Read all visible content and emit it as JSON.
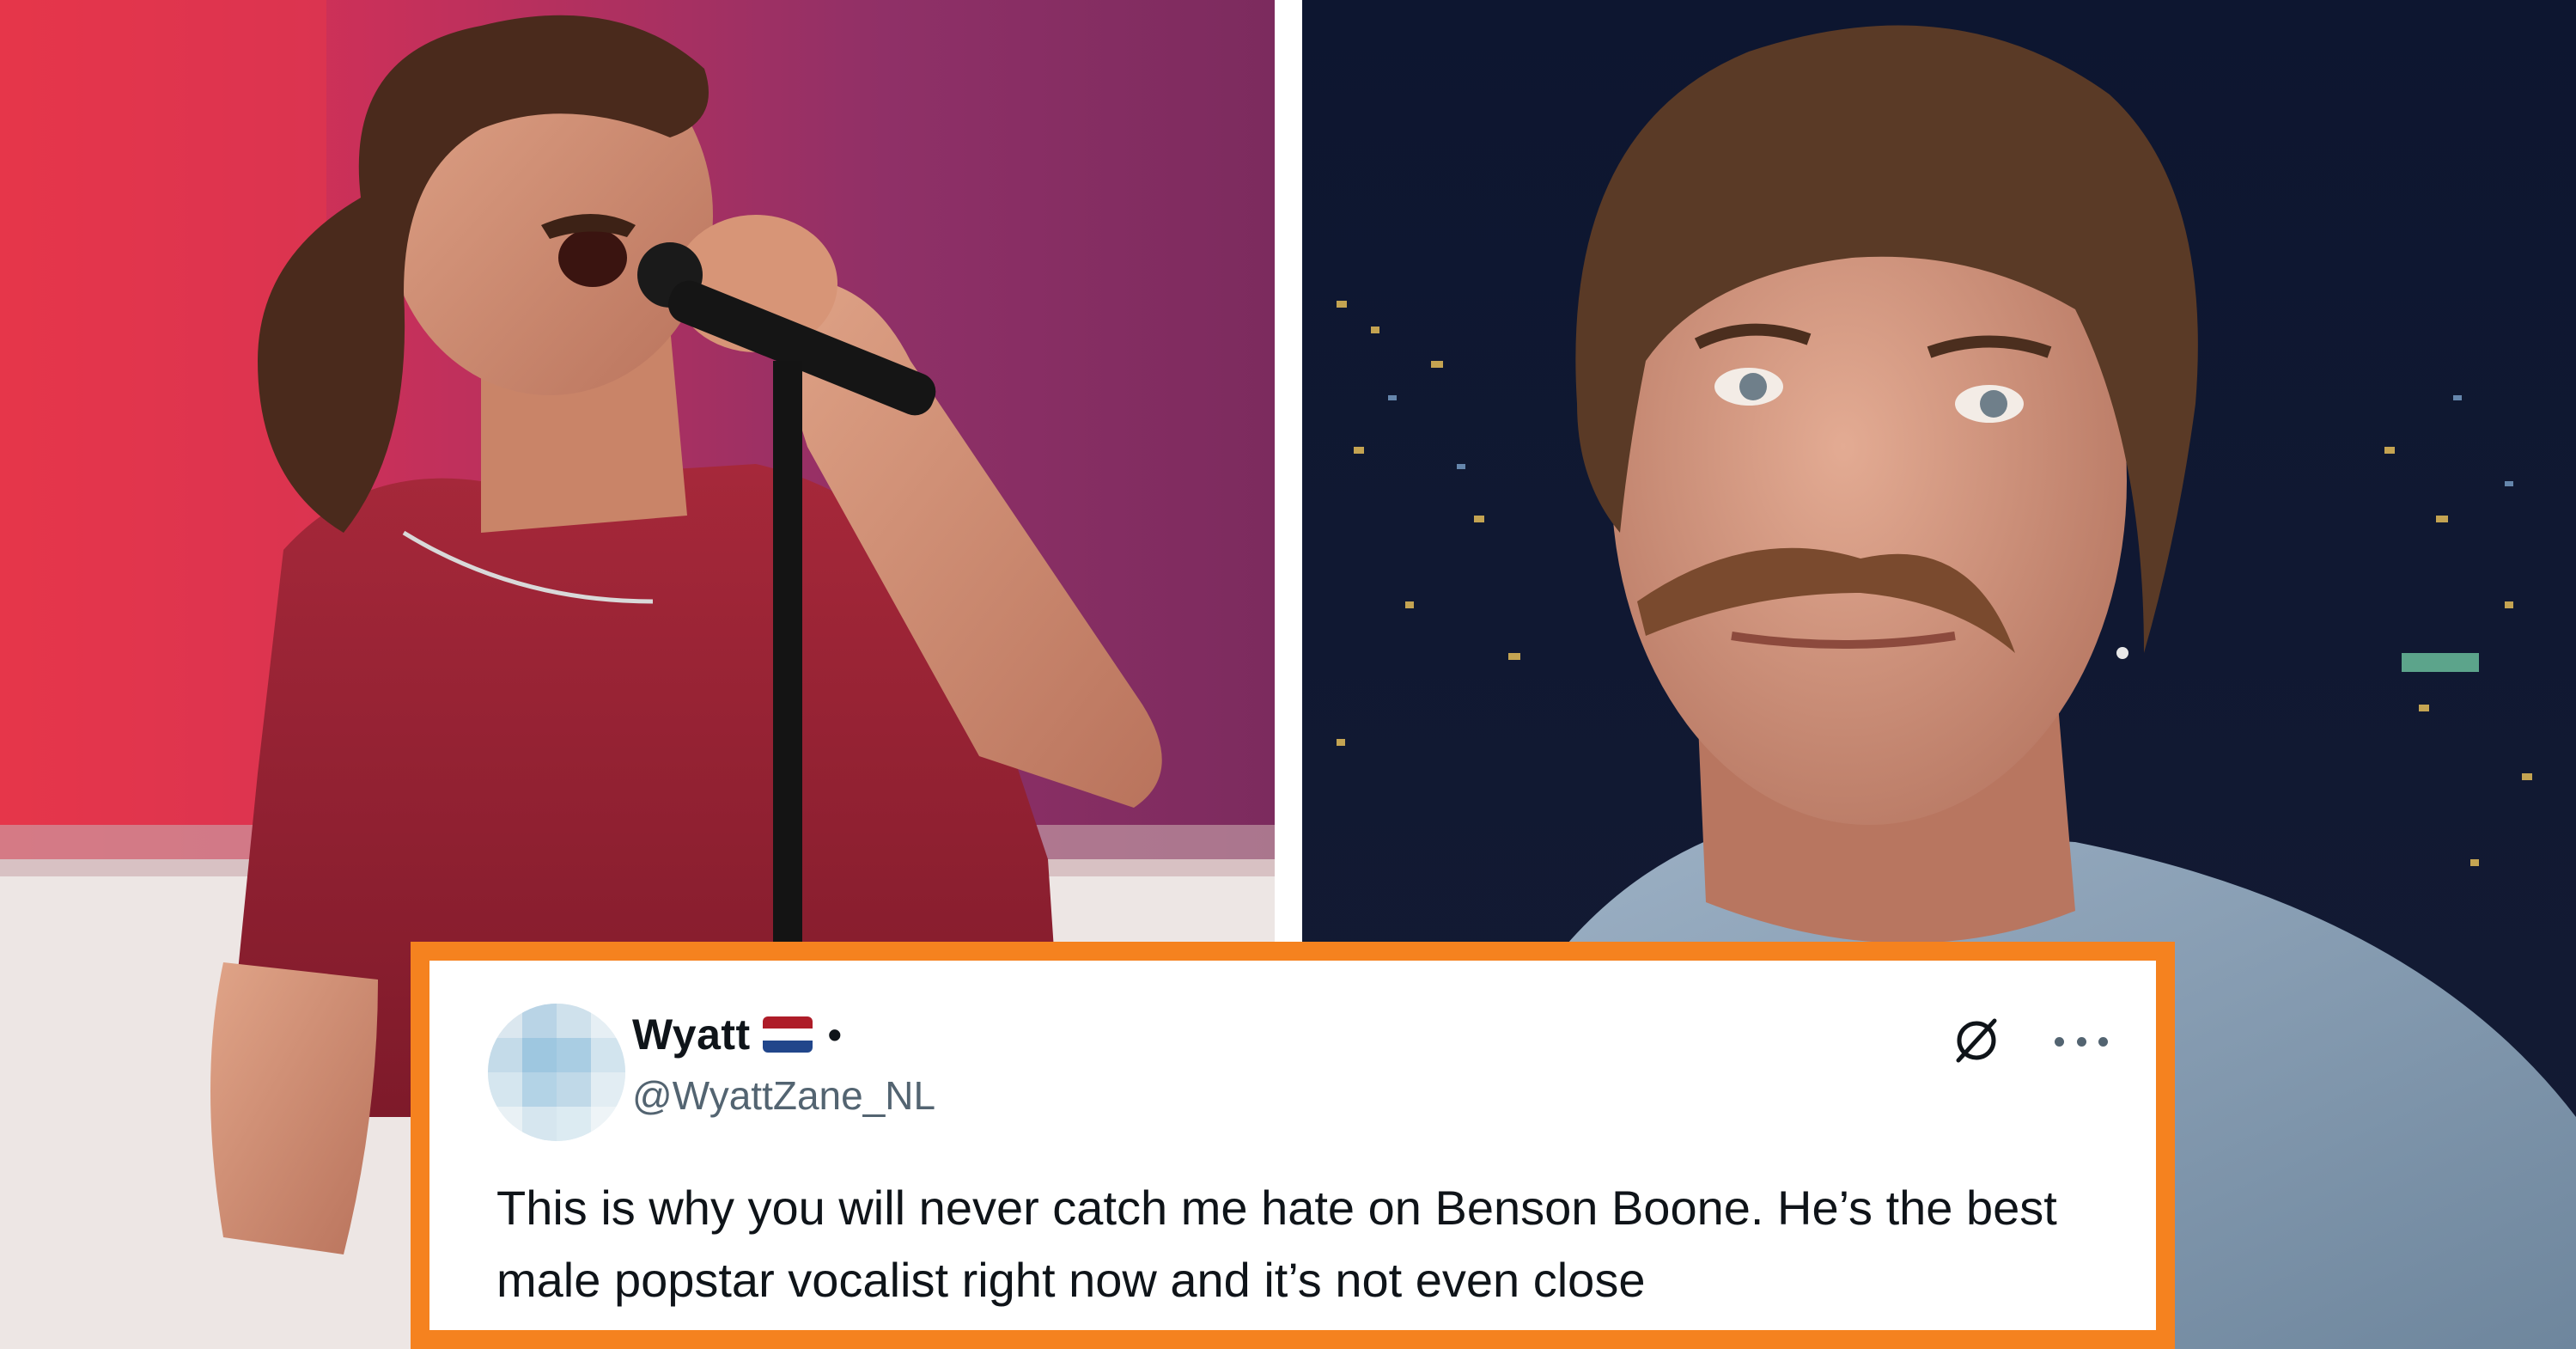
{
  "photos": {
    "left": {
      "subject": "singer performing with microphone on stage"
    },
    "right": {
      "subject": "man with curly hair and mustache on talk show set"
    }
  },
  "tweet": {
    "display_name": "Wyatt",
    "flag_icon": "netherlands-flag-icon",
    "separator": "•",
    "handle": "@WyattZane_NL",
    "text": "This is why you will never catch me hate on Benson Boone. He’s the best male popstar vocalist right now and it’s not even close",
    "grok_icon": "grok-icon",
    "more_icon": "more-options-icon"
  },
  "colors": {
    "frame_orange": "#f5821f",
    "flag_red": "#ae1c28",
    "flag_white": "#ffffff",
    "flag_blue": "#21468b"
  }
}
